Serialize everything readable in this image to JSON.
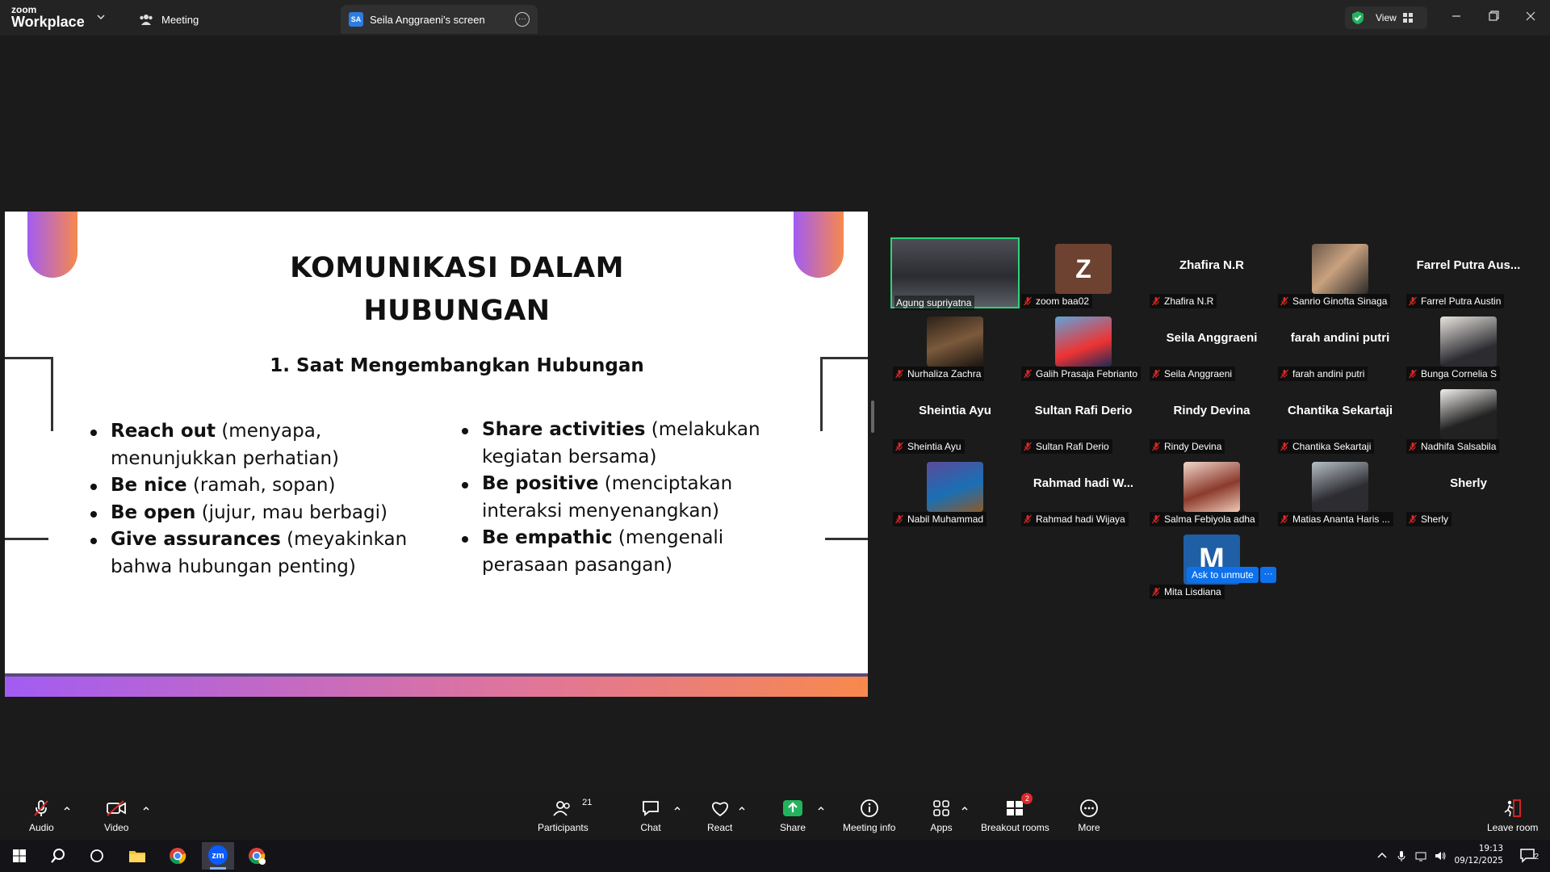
{
  "window": {
    "logo_top": "zoom",
    "logo_bottom": "Workplace",
    "tab_meeting": "Meeting",
    "tab_screen_initials": "SA",
    "tab_screen": "Seila Anggraeni's screen",
    "view_label": "View"
  },
  "slide": {
    "title_line1": "KOMUNIKASI DALAM",
    "title_line2": "HUBUNGAN",
    "subtitle": "1. Saat Mengembangkan Hubungan",
    "left_items": [
      {
        "bold": "Reach out",
        "rest": " (menyapa, menunjukkan perhatian)"
      },
      {
        "bold": "Be nice",
        "rest": " (ramah, sopan)"
      },
      {
        "bold": "Be open",
        "rest": " (jujur, mau berbagi)"
      },
      {
        "bold": "Give assurances",
        "rest": " (meyakinkan bahwa hubungan penting)"
      }
    ],
    "right_items": [
      {
        "bold": "Share activities",
        "rest": " (melakukan kegiatan bersama)"
      },
      {
        "bold": "Be positive",
        "rest": " (menciptakan interaksi menyenangkan)"
      },
      {
        "bold": "Be empathic",
        "rest": " (mengenali perasaan pasangan)"
      }
    ]
  },
  "participants": [
    {
      "name": "Agung supriyatna",
      "kind": "video",
      "active": true
    },
    {
      "name": "zoom baa02",
      "kind": "initial",
      "initial": "Z"
    },
    {
      "name": "Zhafira N.R",
      "kind": "name",
      "big": "Zhafira N.R"
    },
    {
      "name": "Sanrio Ginofta Sinaga",
      "kind": "photo"
    },
    {
      "name": "Farrel Putra Austin",
      "kind": "name",
      "big": "Farrel Putra Aus..."
    },
    {
      "name": "Nurhaliza Zachra",
      "kind": "photo"
    },
    {
      "name": "Galih Prasaja Febrianto",
      "kind": "photo"
    },
    {
      "name": "Seila Anggraeni",
      "kind": "name",
      "big": "Seila Anggraeni"
    },
    {
      "name": "farah andini putri",
      "kind": "name",
      "big": "farah andini putri"
    },
    {
      "name": "Bunga Cornelia S",
      "kind": "photo"
    },
    {
      "name": "Sheintia Ayu",
      "kind": "name",
      "big": "Sheintia Ayu"
    },
    {
      "name": "Sultan Rafi Derio",
      "kind": "name",
      "big": "Sultan Rafi Derio"
    },
    {
      "name": "Rindy Devina",
      "kind": "name",
      "big": "Rindy Devina"
    },
    {
      "name": "Chantika Sekartaji",
      "kind": "name",
      "big": "Chantika Sekartaji"
    },
    {
      "name": "Nadhifa Salsabila",
      "kind": "photo"
    },
    {
      "name": "Nabil Muhammad",
      "kind": "photo"
    },
    {
      "name": "Rahmad hadi Wijaya",
      "kind": "name",
      "big": "Rahmad hadi W..."
    },
    {
      "name": "Salma Febiyola adha",
      "kind": "photo"
    },
    {
      "name": "Matias Ananta Haris ...",
      "kind": "photo"
    },
    {
      "name": "Sherly",
      "kind": "name",
      "big": "Sherly"
    },
    {
      "name": "Mita Lisdiana",
      "kind": "initial",
      "initial": "M"
    }
  ],
  "ask_to_unmute": "Ask to unmute",
  "ask_more": "···",
  "toolbar": {
    "audio": "Audio",
    "video": "Video",
    "participants": "Participants",
    "participants_count": "21",
    "chat": "Chat",
    "react": "React",
    "share": "Share",
    "meeting_info": "Meeting info",
    "apps": "Apps",
    "breakout": "Breakout rooms",
    "breakout_badge": "2",
    "more": "More",
    "leave": "Leave room"
  },
  "taskbar": {
    "time": "19:13",
    "date": "09/12/2025",
    "notif_count": "2"
  },
  "colors": {
    "accent_green": "#2bd47a",
    "zoom_blue": "#0e71eb",
    "mute_red": "#e02828",
    "slide_gradient_start": "#a25cf2",
    "slide_gradient_end": "#f7894d"
  },
  "icons": [
    "shield-check-icon",
    "grid-view-icon",
    "minimize-icon",
    "maximize-icon",
    "close-icon",
    "mic-off-icon",
    "video-off-icon",
    "participants-icon",
    "chat-icon",
    "react-heart-icon",
    "share-arrow-icon",
    "info-icon",
    "apps-icon",
    "breakout-icon",
    "more-icon",
    "leave-icon",
    "windows-start-icon",
    "search-icon",
    "task-view-icon",
    "file-explorer-icon",
    "chrome-icon",
    "zoom-app-icon"
  ]
}
